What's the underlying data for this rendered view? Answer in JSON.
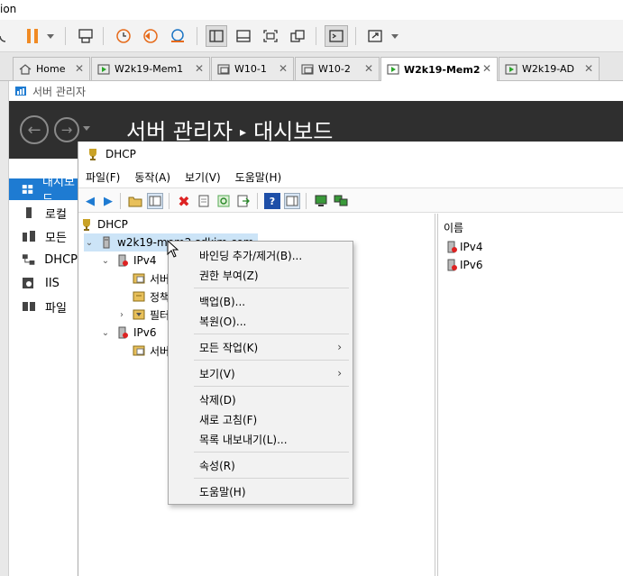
{
  "vm_title": "ion",
  "tabs": [
    {
      "label": "Home",
      "icon": "home-icon",
      "active": false
    },
    {
      "label": "W2k19-Mem1",
      "icon": "vm-running-icon",
      "active": false
    },
    {
      "label": "W10-1",
      "icon": "vm-icon",
      "active": false
    },
    {
      "label": "W10-2",
      "icon": "vm-icon",
      "active": false
    },
    {
      "label": "W2k19-Mem2",
      "icon": "vm-running-icon",
      "active": true
    },
    {
      "label": "W2k19-AD",
      "icon": "vm-running-icon",
      "active": false
    }
  ],
  "server_manager": {
    "window_title": "서버 관리자",
    "header_title": "서버 관리자",
    "header_separator": "▸",
    "header_page": "대시보드",
    "nav": [
      {
        "label": "대시보드",
        "icon": "dashboard-icon",
        "active": true
      },
      {
        "label": "로컬",
        "icon": "local-server-icon",
        "active": false
      },
      {
        "label": "모든",
        "icon": "all-servers-icon",
        "active": false
      },
      {
        "label": "DHCP",
        "icon": "dhcp-icon",
        "active": false
      },
      {
        "label": "IIS",
        "icon": "iis-icon",
        "active": false
      },
      {
        "label": "파일",
        "icon": "file-services-icon",
        "active": false
      }
    ]
  },
  "dhcp": {
    "title": "DHCP",
    "menu": [
      "파일(F)",
      "동작(A)",
      "보기(V)",
      "도움말(H)"
    ],
    "tree": {
      "root": "DHCP",
      "server": "w2k19-mem2.sdkim.com",
      "ipv4": "IPv4",
      "ipv4_children": [
        "서버",
        "정책",
        "필터"
      ],
      "ipv6": "IPv6",
      "ipv6_children": [
        "서버"
      ]
    },
    "detail": {
      "column_header": "이름",
      "rows": [
        "IPv4",
        "IPv6"
      ]
    }
  },
  "context_menu": {
    "groups": [
      [
        "바인딩 추가/제거(B)...",
        "권한 부여(Z)"
      ],
      [
        "백업(B)...",
        "복원(O)..."
      ],
      [
        "모든 작업(K)"
      ],
      [
        "보기(V)"
      ],
      [
        "삭제(D)",
        "새로 고침(F)",
        "목록 내보내기(L)..."
      ],
      [
        "속성(R)"
      ],
      [
        "도움말(H)"
      ]
    ],
    "submenu_arrow": "›"
  },
  "colors": {
    "accent": "#1e7bd2",
    "header_bg": "#2f2f2f",
    "selection": "#cce4f7",
    "pause_orange": "#f08a24"
  }
}
